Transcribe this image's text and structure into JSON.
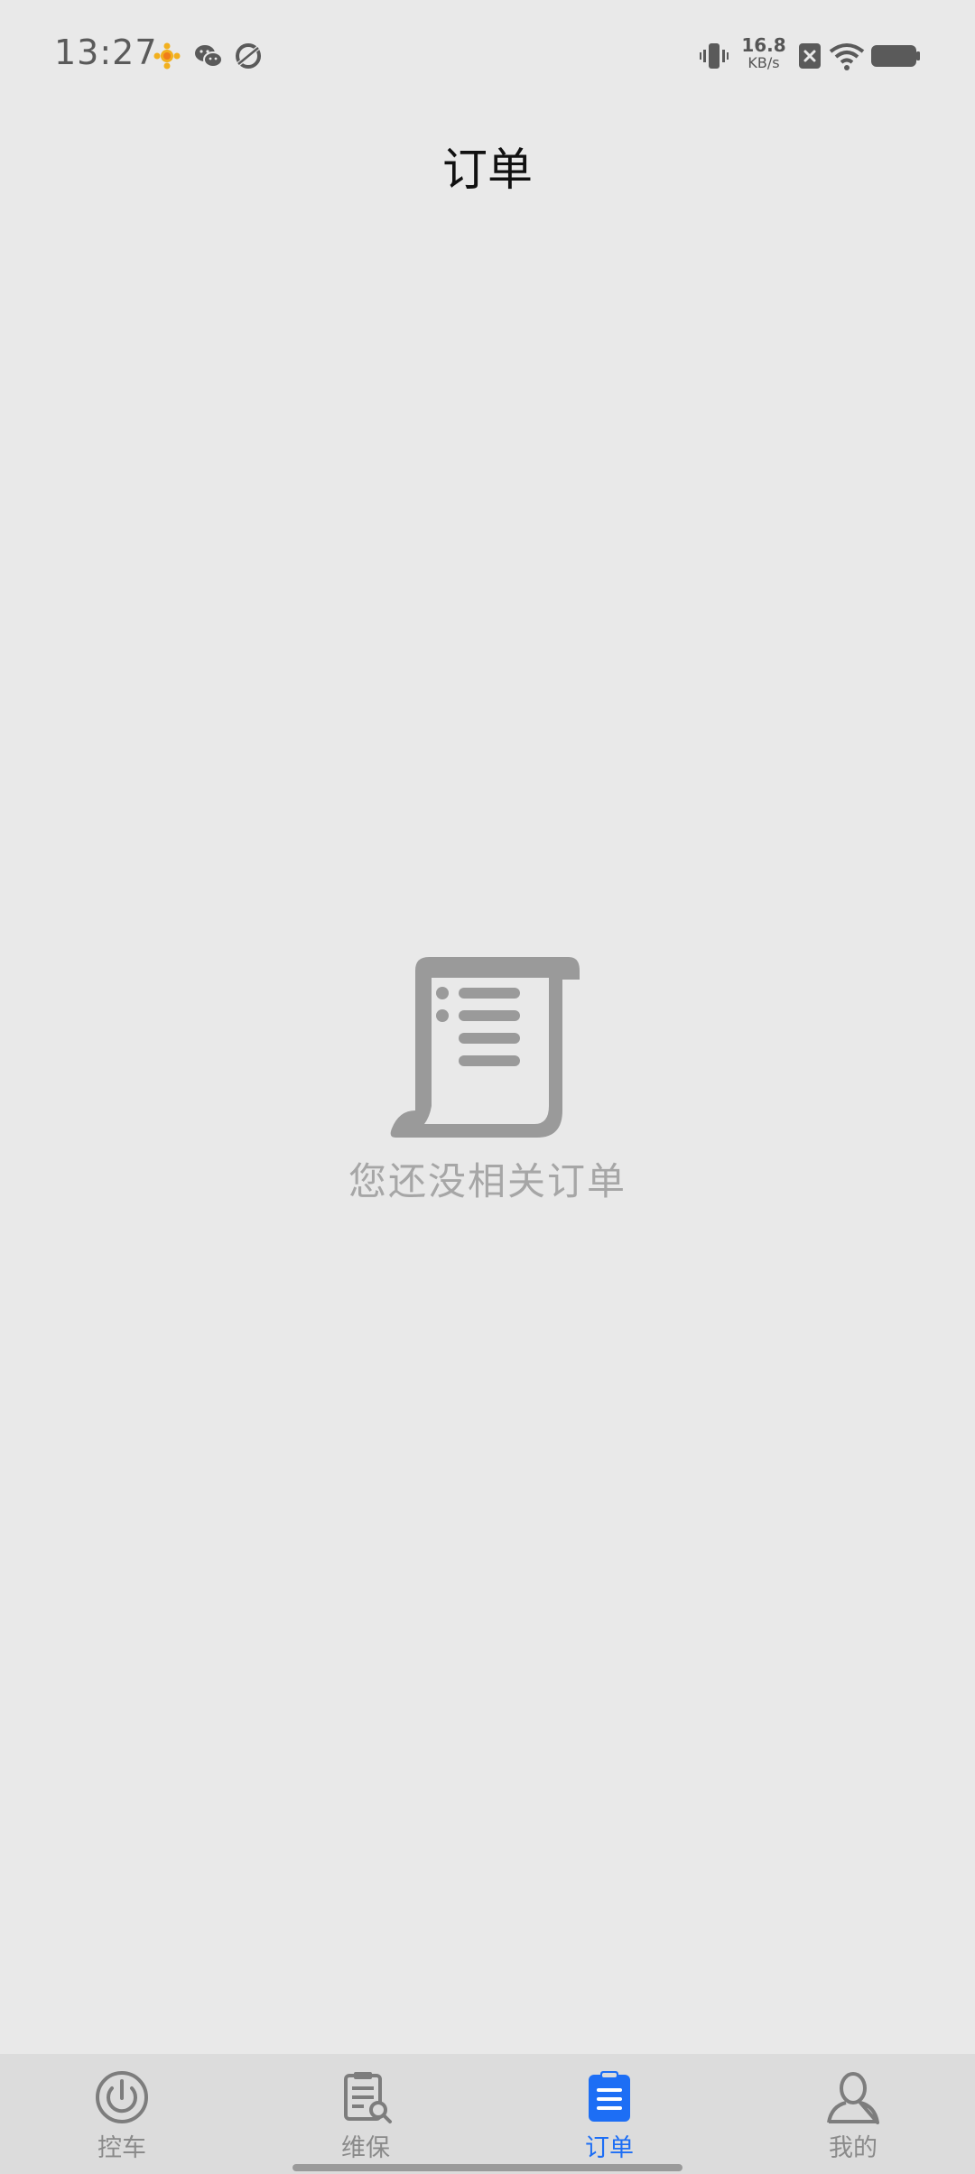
{
  "status_bar": {
    "time": "13:27",
    "net_speed_value": "16.8",
    "net_speed_unit": "KB/s",
    "left_icons": [
      "sun-app-icon",
      "wechat-icon",
      "orbit-app-icon"
    ],
    "right_icons": [
      "vibrate-icon",
      "sim-off-icon",
      "wifi-icon",
      "battery-icon"
    ]
  },
  "header": {
    "title": "订单"
  },
  "empty_state": {
    "icon": "document-scroll-icon",
    "message": "您还没相关订单"
  },
  "bottom_nav": {
    "active_index": 2,
    "active_color": "#1d6ef5",
    "items": [
      {
        "label": "控车",
        "icon": "power-icon"
      },
      {
        "label": "维保",
        "icon": "maintenance-icon"
      },
      {
        "label": "订单",
        "icon": "clipboard-list-icon"
      },
      {
        "label": "我的",
        "icon": "user-icon"
      }
    ]
  }
}
